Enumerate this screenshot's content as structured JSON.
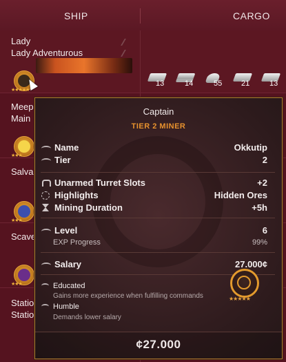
{
  "tabs": {
    "ship": "SHIP",
    "cargo": "CARGO"
  },
  "ships": [
    {
      "line1": "Lady",
      "line2": "Lady Adventurous"
    },
    {
      "line1": "Meep",
      "line2": "Main"
    },
    {
      "line1": "Salva",
      "line2": ""
    },
    {
      "line1": "Scave",
      "line2": ""
    },
    {
      "line1": "Statio",
      "line2": "Statio"
    }
  ],
  "cargo": [
    {
      "qty": "13",
      "icon": "ingot-icon"
    },
    {
      "qty": "14",
      "icon": "plates-icon"
    },
    {
      "qty": "55",
      "icon": "ore-icon"
    },
    {
      "qty": "21",
      "icon": "ingot-icon"
    },
    {
      "qty": "13",
      "icon": "ingot-icon"
    }
  ],
  "tooltip": {
    "title": "Captain",
    "subtitle": "TIER 2 MINER",
    "name_label": "Name",
    "name_value": "Okkutip",
    "tier_label": "Tier",
    "tier_value": "2",
    "turret_label": "Unarmed Turret Slots",
    "turret_value": "+2",
    "highlights_label": "Highlights",
    "highlights_value": "Hidden Ores",
    "duration_label": "Mining Duration",
    "duration_value": "+5h",
    "level_label": "Level",
    "level_value": "6",
    "exp_label": "EXP Progress",
    "exp_value": "99%",
    "salary_label": "Salary",
    "salary_value": "27.000¢",
    "traits": [
      {
        "name": "Educated",
        "desc": "Gains more experience when fulfilling commands"
      },
      {
        "name": "Humble",
        "desc": "Demands lower salary"
      }
    ],
    "price": "¢27.000"
  },
  "colors": {
    "accent": "#e8922e",
    "background": "#55131f",
    "panel": "#2e1b1d"
  }
}
